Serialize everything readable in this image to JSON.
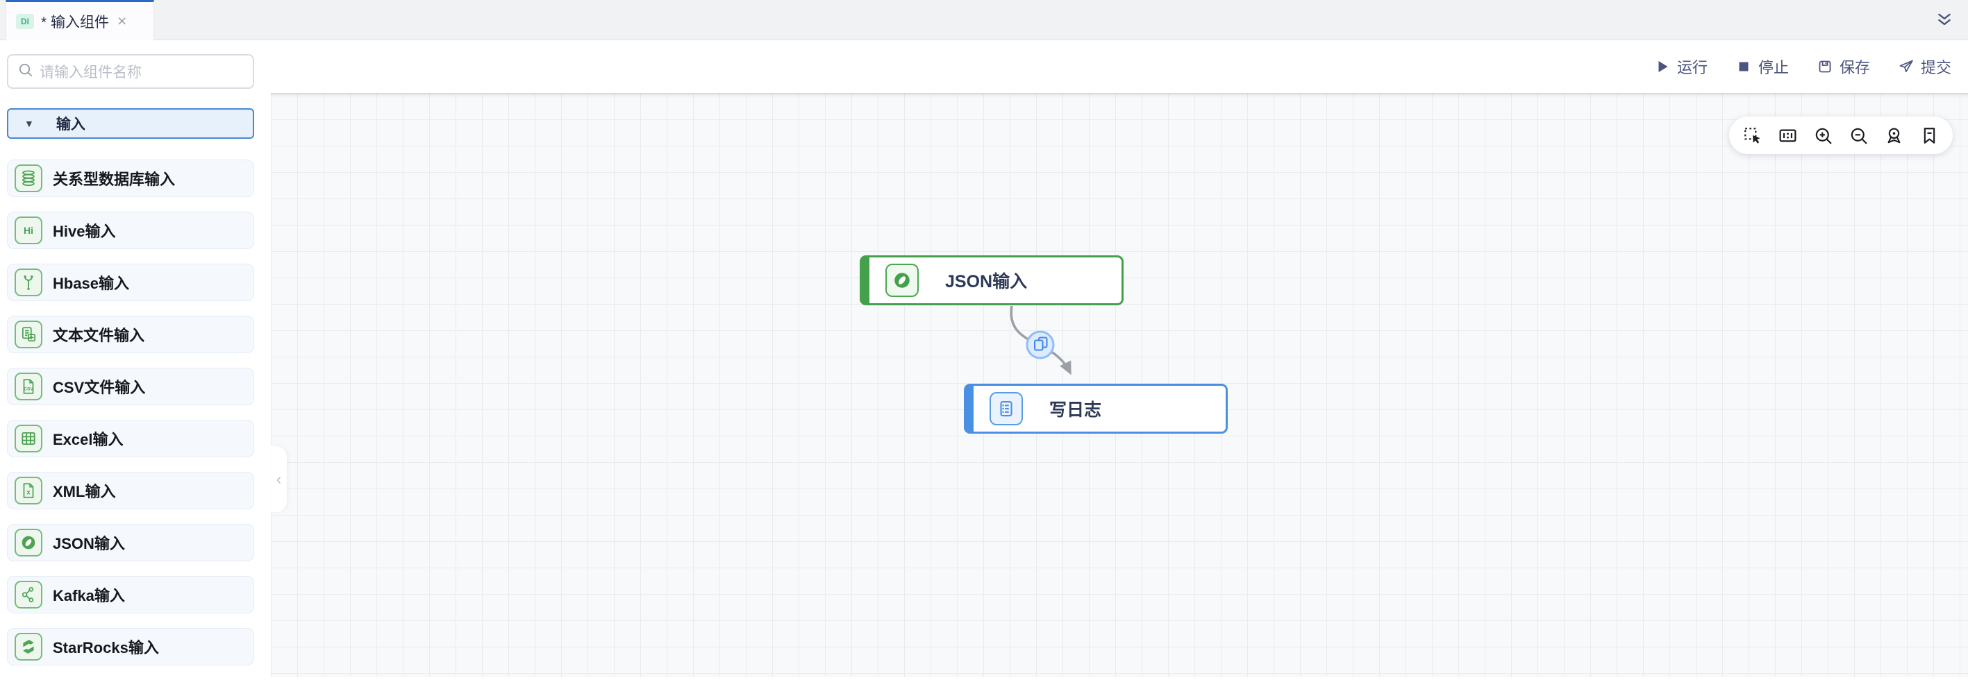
{
  "tab": {
    "badge": "DI",
    "title": "* 输入组件",
    "close": "×"
  },
  "actions": [
    {
      "label": "运行",
      "icon": "run-icon"
    },
    {
      "label": "停止",
      "icon": "stop-icon"
    },
    {
      "label": "保存",
      "icon": "save-icon"
    },
    {
      "label": "提交",
      "icon": "submit-icon"
    }
  ],
  "sidebar": {
    "search_placeholder": "请输入组件名称",
    "section_label": "输入",
    "items": [
      {
        "label": "关系型数据库输入",
        "icon": "database-icon"
      },
      {
        "label": "Hive输入",
        "icon": "hive-icon"
      },
      {
        "label": "Hbase输入",
        "icon": "hbase-icon"
      },
      {
        "label": "文本文件输入",
        "icon": "text-file-icon"
      },
      {
        "label": "CSV文件输入",
        "icon": "csv-file-icon"
      },
      {
        "label": "Excel输入",
        "icon": "excel-icon"
      },
      {
        "label": "XML输入",
        "icon": "xml-file-icon"
      },
      {
        "label": "JSON输入",
        "icon": "json-icon"
      },
      {
        "label": "Kafka输入",
        "icon": "kafka-icon"
      },
      {
        "label": "StarRocks输入",
        "icon": "starrocks-icon"
      }
    ]
  },
  "canvas": {
    "controls": [
      "marquee-select-icon",
      "fit-view-icon",
      "zoom-in-icon",
      "zoom-out-icon",
      "locate-icon",
      "bookmark-icon"
    ],
    "nodes": [
      {
        "label": "JSON输入",
        "icon": "json-icon",
        "color": "#44a04a"
      },
      {
        "label": "写日志",
        "icon": "log-icon",
        "color": "#4a90e2"
      }
    ],
    "edge": {
      "badge_icon": "copy-icon"
    }
  },
  "colors": {
    "tab_accent": "#2a69c6",
    "node_green": "#44a04a",
    "node_blue": "#4a90e2",
    "badge_bg": "#d9f3e8",
    "badge_text": "#35b287",
    "action_text": "#4c5480",
    "edge_gray": "#9aa0a6"
  }
}
